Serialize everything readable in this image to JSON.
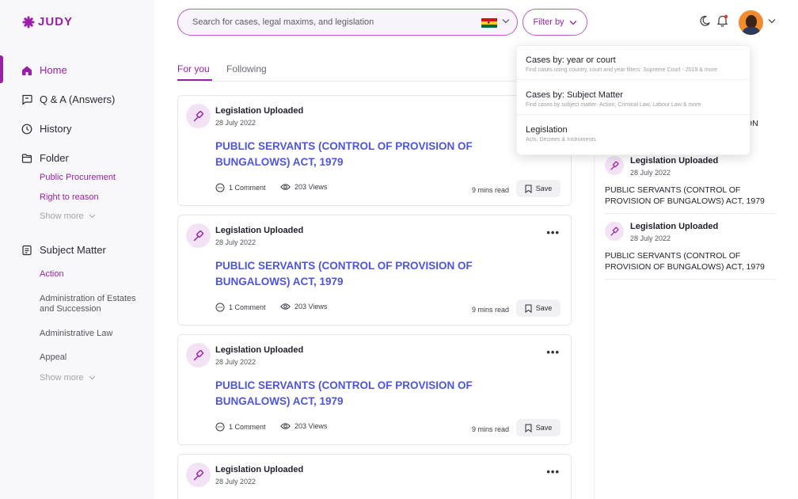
{
  "brand": {
    "name": "JUDY",
    "color": "#9a1fa8"
  },
  "search": {
    "placeholder": "Search for cases, legal maxims, and legislation",
    "country_flag": "ghana-flag"
  },
  "filter": {
    "label": "Filter by"
  },
  "sidebar": {
    "nav": [
      {
        "label": "Home",
        "icon": "home-icon",
        "active": true
      },
      {
        "label": "Q & A (Answers)",
        "icon": "chat-icon"
      },
      {
        "label": "History",
        "icon": "clock-icon"
      },
      {
        "label": "Folder",
        "icon": "folder-icon"
      },
      {
        "label": "Subject Matter",
        "icon": "document-icon"
      }
    ],
    "folders": [
      "Public Procurement",
      "Right to reason"
    ],
    "folders_show_more": "Show more",
    "subjects": [
      "Action",
      "Administration of Estates and Succession",
      "Administrative Law",
      "Appeal"
    ],
    "subjects_show_more": "Show more"
  },
  "tabs": [
    {
      "label": "For you",
      "active": true
    },
    {
      "label": "Following",
      "active": false
    }
  ],
  "feed": [
    {
      "type": "Legislation Uploaded",
      "date": "28 July 2022",
      "title": "PUBLIC SERVANTS (CONTROL OF PROVISION OF BUNGALOWS) ACT, 1979",
      "comments": "1 Comment",
      "views": "203 Views",
      "read_time": "9 mins read",
      "save_label": "Save"
    },
    {
      "type": "Legislation Uploaded",
      "date": "28 July 2022",
      "title": "PUBLIC SERVANTS (CONTROL OF PROVISION OF BUNGALOWS) ACT, 1979",
      "comments": "1 Comment",
      "views": "203 Views",
      "read_time": "9 mins read",
      "save_label": "Save"
    },
    {
      "type": "Legislation Uploaded",
      "date": "28 July 2022",
      "title": "PUBLIC SERVANTS (CONTROL OF PROVISION OF BUNGALOWS) ACT, 1979",
      "comments": "1 Comment",
      "views": "203 Views",
      "read_time": "9 mins read",
      "save_label": "Save"
    },
    {
      "type": "Legislation Uploaded",
      "date": "28 July 2022"
    }
  ],
  "right_column": {
    "partial_text": "SION",
    "items": [
      {
        "type": "Legislation Uploaded",
        "date": "28 July 2022",
        "title": "PUBLIC SERVANTS (CONTROL OF PROVISION OF BUNGALOWS) ACT, 1979"
      },
      {
        "type": "Legislation Uploaded",
        "date": "28 July 2022",
        "title": "PUBLIC SERVANTS (CONTROL OF PROVISION OF BUNGALOWS) ACT, 1979"
      }
    ]
  },
  "filter_dropdown": [
    {
      "title": "Cases by: year or court",
      "subtitle": "Find cases using country, court and year filters: Supreme Court - 2019 & more"
    },
    {
      "title": "Cases by: Subject Matter",
      "subtitle": "Find cases by subject matter- Action, Criminal Law, Labour Law & more"
    },
    {
      "title": "Legislation",
      "subtitle": "Acts, Decrees & Instruments"
    }
  ]
}
